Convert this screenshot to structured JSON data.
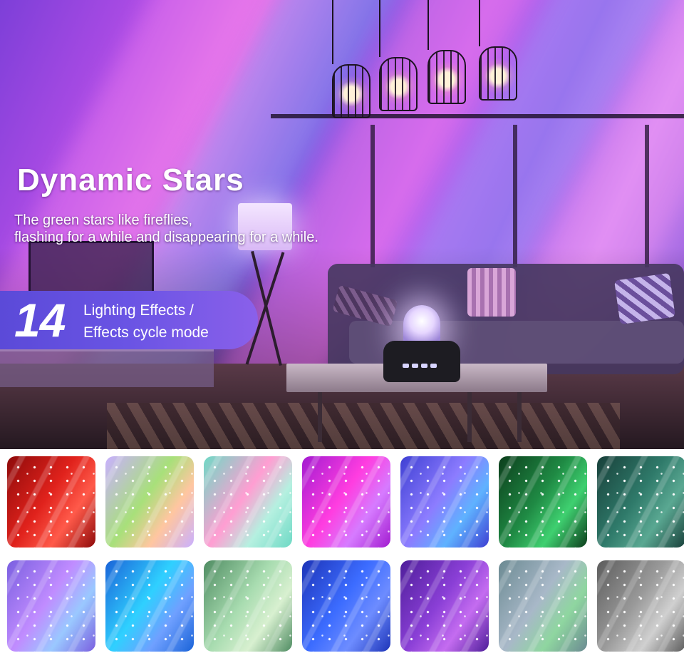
{
  "hero": {
    "headline": "Dynamic Stars",
    "subtext_line1": "The green stars like fireflies,",
    "subtext_line2": "flashing for a while and disappearing for a while.",
    "badge_number": "14",
    "badge_line1": "Lighting Effects /",
    "badge_line2": "Effects cycle mode",
    "badge_color": "#6a54e4"
  },
  "swatches": [
    {
      "name": "red",
      "colors": [
        "#8e0a0a",
        "#e0221c",
        "#ff5a4a"
      ]
    },
    {
      "name": "multicolor-pastel",
      "colors": [
        "#c9b0ff",
        "#a8e07a",
        "#ffc6a0"
      ]
    },
    {
      "name": "teal-pink",
      "colors": [
        "#6ed9c5",
        "#ff9ed2",
        "#b5f0e0"
      ]
    },
    {
      "name": "magenta",
      "colors": [
        "#a21bd0",
        "#ff3de0",
        "#d67bff"
      ]
    },
    {
      "name": "blue-violet",
      "colors": [
        "#3e3fd3",
        "#8c7cff",
        "#5fb2ff"
      ]
    },
    {
      "name": "dark-green",
      "colors": [
        "#0c3e1c",
        "#1f8a44",
        "#3fd070"
      ]
    },
    {
      "name": "dark-teal",
      "colors": [
        "#18403a",
        "#2f7a6a",
        "#5aa892"
      ]
    },
    {
      "name": "lavender",
      "colors": [
        "#7a5fe0",
        "#c08cff",
        "#9ac8ff"
      ]
    },
    {
      "name": "cyan-blue",
      "colors": [
        "#1a63d8",
        "#2fd0ff",
        "#6fa0ff"
      ]
    },
    {
      "name": "sage",
      "colors": [
        "#4f8c62",
        "#a8dcb0",
        "#d8f0d0"
      ]
    },
    {
      "name": "royal-blue",
      "colors": [
        "#1d34b8",
        "#3c6cff",
        "#6d8cff"
      ]
    },
    {
      "name": "purple",
      "colors": [
        "#4e1e9a",
        "#8a3fd6",
        "#c46cf0"
      ]
    },
    {
      "name": "gray-green",
      "colors": [
        "#6b8a92",
        "#a8b8c8",
        "#8fd6a0"
      ]
    },
    {
      "name": "gray",
      "colors": [
        "#5c5c5c",
        "#9a9a9a",
        "#d0d0d0"
      ]
    }
  ]
}
